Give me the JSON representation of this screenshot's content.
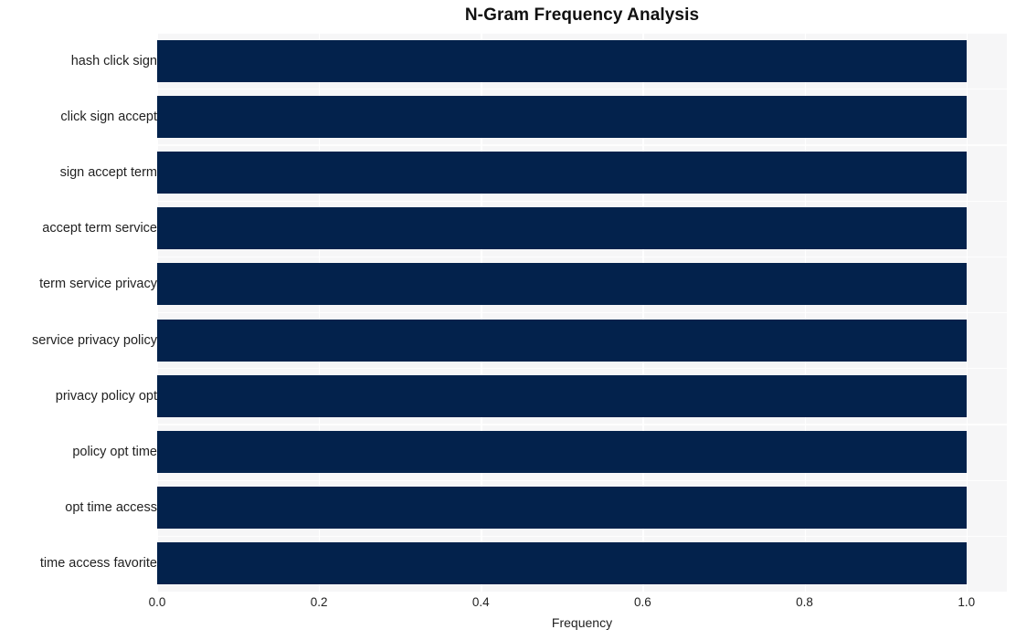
{
  "chart_data": {
    "type": "bar",
    "orientation": "horizontal",
    "title": "N-Gram Frequency Analysis",
    "xlabel": "Frequency",
    "ylabel": "",
    "categories": [
      "hash click sign",
      "click sign accept",
      "sign accept term",
      "accept term service",
      "term service privacy",
      "service privacy policy",
      "privacy policy opt",
      "policy opt time",
      "opt time access",
      "time access favorite"
    ],
    "values": [
      1.0,
      1.0,
      1.0,
      1.0,
      1.0,
      1.0,
      1.0,
      1.0,
      1.0,
      1.0
    ],
    "xlim": [
      0.0,
      1.05
    ],
    "xticks": [
      "0.0",
      "0.2",
      "0.4",
      "0.6",
      "0.8",
      "1.0"
    ],
    "xtick_values": [
      0.0,
      0.2,
      0.4,
      0.6,
      0.8,
      1.0
    ],
    "grid": true,
    "grid_color": "#FFFFFF",
    "legend": null,
    "bar_color": "#03224C",
    "plot_background": "#F6F6F7",
    "figure_background": "#FFFFFF",
    "text_color": "#222222"
  }
}
